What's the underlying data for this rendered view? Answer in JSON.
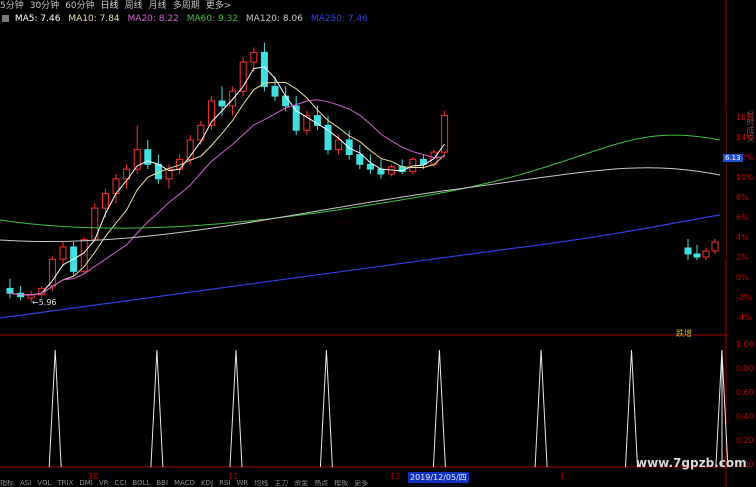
{
  "toolbar": {
    "items": [
      "5分钟",
      "30分钟",
      "60分钟",
      "日线",
      "周线",
      "月线",
      "多周期",
      "更多>"
    ],
    "active_index": 3
  },
  "ma_legend": {
    "ma5": "MA5: 7.46",
    "ma10": "MA10: 7.84",
    "ma20": "MA20: 8.22",
    "ma60": "MA60: 9.32",
    "ma120": "MA120: 8.06",
    "ma250": "MA250: 7.46",
    "colors": {
      "ma5": "#ffffff",
      "ma10": "#e8e0a0",
      "ma20": "#d060d0",
      "ma60": "#40c040",
      "ma120": "#c8c8c8",
      "ma250": "#3040e0"
    }
  },
  "price_scale": [
    "16%",
    "14%",
    "12%",
    "10%",
    "8%",
    "6%",
    "4%",
    "2%",
    "0%",
    "-2%",
    "-4%"
  ],
  "price_badge": "6.13",
  "right_vertical_text": "分时成交",
  "indicator_scale": [
    "1.00",
    "0.80",
    "0.60",
    "0.40",
    "0.20",
    "0.00"
  ],
  "low_label": "←5.96",
  "signal_tag": "跌增",
  "date_axis": {
    "labels": [
      "10",
      "11",
      "12",
      "1"
    ],
    "cursor": "2019/12/05/四"
  },
  "bottom_tabs": [
    "指标",
    "ASI",
    "VOL",
    "TRIX",
    "DMI",
    "VR",
    "CCI",
    "BOLL",
    "BBI",
    "MACD",
    "KDJ",
    "RSI",
    "WR",
    "均线",
    "主力",
    "资金",
    "热点",
    "模板",
    "更多"
  ],
  "watermark": "www.7gpzb.com",
  "chart_data": {
    "type": "candlestick",
    "indicator_type": "spikes",
    "title": "",
    "ma_names": [
      "MA5",
      "MA10",
      "MA20",
      "MA60",
      "MA120",
      "MA250"
    ],
    "candles": [
      {
        "o": 6.25,
        "h": 6.45,
        "l": 6.05,
        "c": 6.15
      },
      {
        "o": 6.15,
        "h": 6.3,
        "l": 6.0,
        "c": 6.08
      },
      {
        "o": 6.05,
        "h": 6.2,
        "l": 5.96,
        "c": 6.12
      },
      {
        "o": 6.12,
        "h": 6.3,
        "l": 6.05,
        "c": 6.25
      },
      {
        "o": 6.3,
        "h": 6.9,
        "l": 6.2,
        "c": 6.85
      },
      {
        "o": 6.85,
        "h": 7.2,
        "l": 6.7,
        "c": 7.1
      },
      {
        "o": 7.1,
        "h": 7.2,
        "l": 6.5,
        "c": 6.6
      },
      {
        "o": 6.6,
        "h": 7.3,
        "l": 6.55,
        "c": 7.25
      },
      {
        "o": 7.25,
        "h": 8.0,
        "l": 7.2,
        "c": 7.9
      },
      {
        "o": 7.9,
        "h": 8.3,
        "l": 7.7,
        "c": 8.2
      },
      {
        "o": 8.2,
        "h": 8.6,
        "l": 8.0,
        "c": 8.5
      },
      {
        "o": 8.5,
        "h": 8.8,
        "l": 8.3,
        "c": 8.7
      },
      {
        "o": 8.7,
        "h": 9.6,
        "l": 8.6,
        "c": 9.1
      },
      {
        "o": 9.1,
        "h": 9.3,
        "l": 8.7,
        "c": 8.8
      },
      {
        "o": 8.8,
        "h": 9.0,
        "l": 8.4,
        "c": 8.5
      },
      {
        "o": 8.5,
        "h": 8.8,
        "l": 8.3,
        "c": 8.7
      },
      {
        "o": 8.7,
        "h": 9.0,
        "l": 8.6,
        "c": 8.9
      },
      {
        "o": 8.9,
        "h": 9.4,
        "l": 8.8,
        "c": 9.3
      },
      {
        "o": 9.3,
        "h": 9.7,
        "l": 9.2,
        "c": 9.6
      },
      {
        "o": 9.6,
        "h": 10.2,
        "l": 9.5,
        "c": 10.1
      },
      {
        "o": 10.1,
        "h": 10.4,
        "l": 9.8,
        "c": 10.0
      },
      {
        "o": 10.0,
        "h": 10.4,
        "l": 9.8,
        "c": 10.3
      },
      {
        "o": 10.3,
        "h": 11.0,
        "l": 10.2,
        "c": 10.9
      },
      {
        "o": 10.9,
        "h": 11.2,
        "l": 10.7,
        "c": 11.1
      },
      {
        "o": 11.1,
        "h": 11.3,
        "l": 10.3,
        "c": 10.4
      },
      {
        "o": 10.4,
        "h": 10.6,
        "l": 10.1,
        "c": 10.2
      },
      {
        "o": 10.2,
        "h": 10.4,
        "l": 9.9,
        "c": 10.0
      },
      {
        "o": 10.0,
        "h": 10.2,
        "l": 9.4,
        "c": 9.5
      },
      {
        "o": 9.5,
        "h": 9.9,
        "l": 9.4,
        "c": 9.8
      },
      {
        "o": 9.8,
        "h": 10.0,
        "l": 9.5,
        "c": 9.6
      },
      {
        "o": 9.6,
        "h": 9.8,
        "l": 9.0,
        "c": 9.1
      },
      {
        "o": 9.1,
        "h": 9.4,
        "l": 9.0,
        "c": 9.3
      },
      {
        "o": 9.3,
        "h": 9.5,
        "l": 8.9,
        "c": 9.0
      },
      {
        "o": 9.0,
        "h": 9.2,
        "l": 8.7,
        "c": 8.8
      },
      {
        "o": 8.8,
        "h": 9.0,
        "l": 8.6,
        "c": 8.7
      },
      {
        "o": 8.7,
        "h": 8.9,
        "l": 8.5,
        "c": 8.6
      },
      {
        "o": 8.6,
        "h": 8.8,
        "l": 8.55,
        "c": 8.75
      },
      {
        "o": 8.75,
        "h": 8.9,
        "l": 8.6,
        "c": 8.65
      },
      {
        "o": 8.65,
        "h": 8.95,
        "l": 8.6,
        "c": 8.9
      },
      {
        "o": 8.9,
        "h": 9.0,
        "l": 8.7,
        "c": 8.8
      },
      {
        "o": 8.8,
        "h": 9.1,
        "l": 8.75,
        "c": 9.05
      },
      {
        "o": 9.05,
        "h": 9.9,
        "l": 9.0,
        "c": 9.8
      }
    ],
    "candles_right": [
      {
        "o": 7.4,
        "h": 7.7,
        "l": 7.0,
        "c": 7.2
      },
      {
        "o": 7.2,
        "h": 7.5,
        "l": 7.0,
        "c": 7.1
      },
      {
        "o": 7.1,
        "h": 7.4,
        "l": 7.0,
        "c": 7.3
      },
      {
        "o": 7.3,
        "h": 7.7,
        "l": 7.2,
        "c": 7.6
      }
    ],
    "spikes_x_index": [
      4,
      13,
      20,
      28,
      38,
      47,
      55,
      63
    ],
    "indicator_ylim": [
      0,
      1
    ],
    "ylim": [
      5.6,
      11.6
    ]
  }
}
